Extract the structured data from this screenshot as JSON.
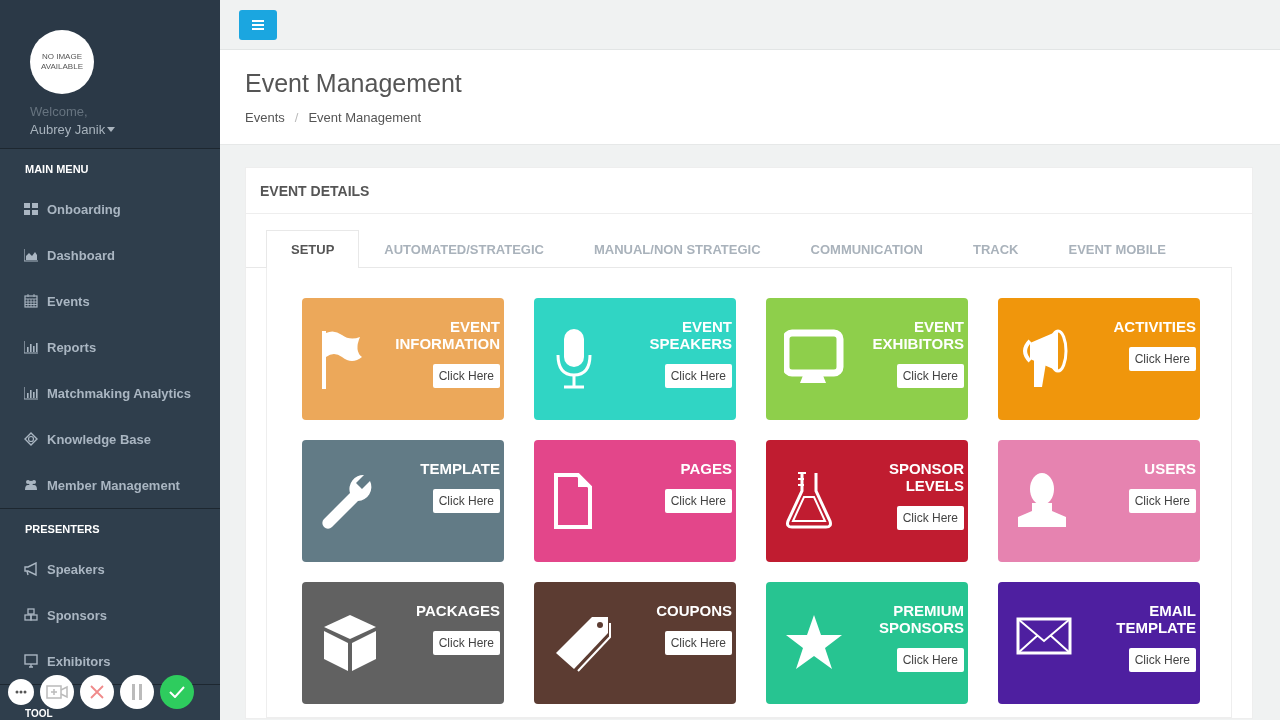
{
  "sidebar": {
    "avatar_text": "NO IMAGE AVAILABLE",
    "welcome": "Welcome,",
    "user": "Aubrey Janik",
    "sections": [
      {
        "title": "MAIN MENU",
        "items": [
          {
            "label": "Onboarding"
          },
          {
            "label": "Dashboard"
          },
          {
            "label": "Events"
          },
          {
            "label": "Reports"
          },
          {
            "label": "Matchmaking Analytics"
          },
          {
            "label": "Knowledge Base"
          },
          {
            "label": "Member Management"
          }
        ]
      },
      {
        "title": "PRESENTERS",
        "items": [
          {
            "label": "Speakers"
          },
          {
            "label": "Sponsors"
          },
          {
            "label": "Exhibitors"
          }
        ]
      },
      {
        "title": "TOOL"
      }
    ]
  },
  "page": {
    "title": "Event Management",
    "breadcrumb": [
      "Events",
      "Event Management"
    ],
    "breadcrumb_separator": "/"
  },
  "panel": {
    "title": "EVENT DETAILS",
    "tabs": [
      {
        "label": "SETUP",
        "selected": true
      },
      {
        "label": "AUTOMATED/STRATEGIC",
        "selected": false
      },
      {
        "label": "MANUAL/NON STRATEGIC",
        "selected": false
      },
      {
        "label": "COMMUNICATION",
        "selected": false
      },
      {
        "label": "TRACK",
        "selected": false
      },
      {
        "label": "EVENT MOBILE",
        "selected": false
      }
    ],
    "tiles": [
      {
        "title": "EVENT INFORMATION",
        "button": "Click Here",
        "color": "#eca85a"
      },
      {
        "title": "EVENT SPEAKERS",
        "button": "Click Here",
        "color": "#30d5c4"
      },
      {
        "title": "EVENT EXHIBITORS",
        "button": "Click Here",
        "color": "#8ecf4b"
      },
      {
        "title": "ACTIVITIES",
        "button": "Click Here",
        "color": "#f0960c"
      },
      {
        "title": "TEMPLATE",
        "button": "Click Here",
        "color": "#627b86"
      },
      {
        "title": "PAGES",
        "button": "Click Here",
        "color": "#e3468a"
      },
      {
        "title": "SPONSOR LEVELS",
        "button": "Click Here",
        "color": "#c01c30"
      },
      {
        "title": "USERS",
        "button": "Click Here",
        "color": "#e683b0"
      },
      {
        "title": "PACKAGES",
        "button": "Click Here",
        "color": "#616161"
      },
      {
        "title": "COUPONS",
        "button": "Click Here",
        "color": "#5c3c32"
      },
      {
        "title": "PREMIUM SPONSORS",
        "button": "Click Here",
        "color": "#27c491"
      },
      {
        "title": "EMAIL TEMPLATE",
        "button": "Click Here",
        "color": "#4e1fa0"
      }
    ]
  }
}
